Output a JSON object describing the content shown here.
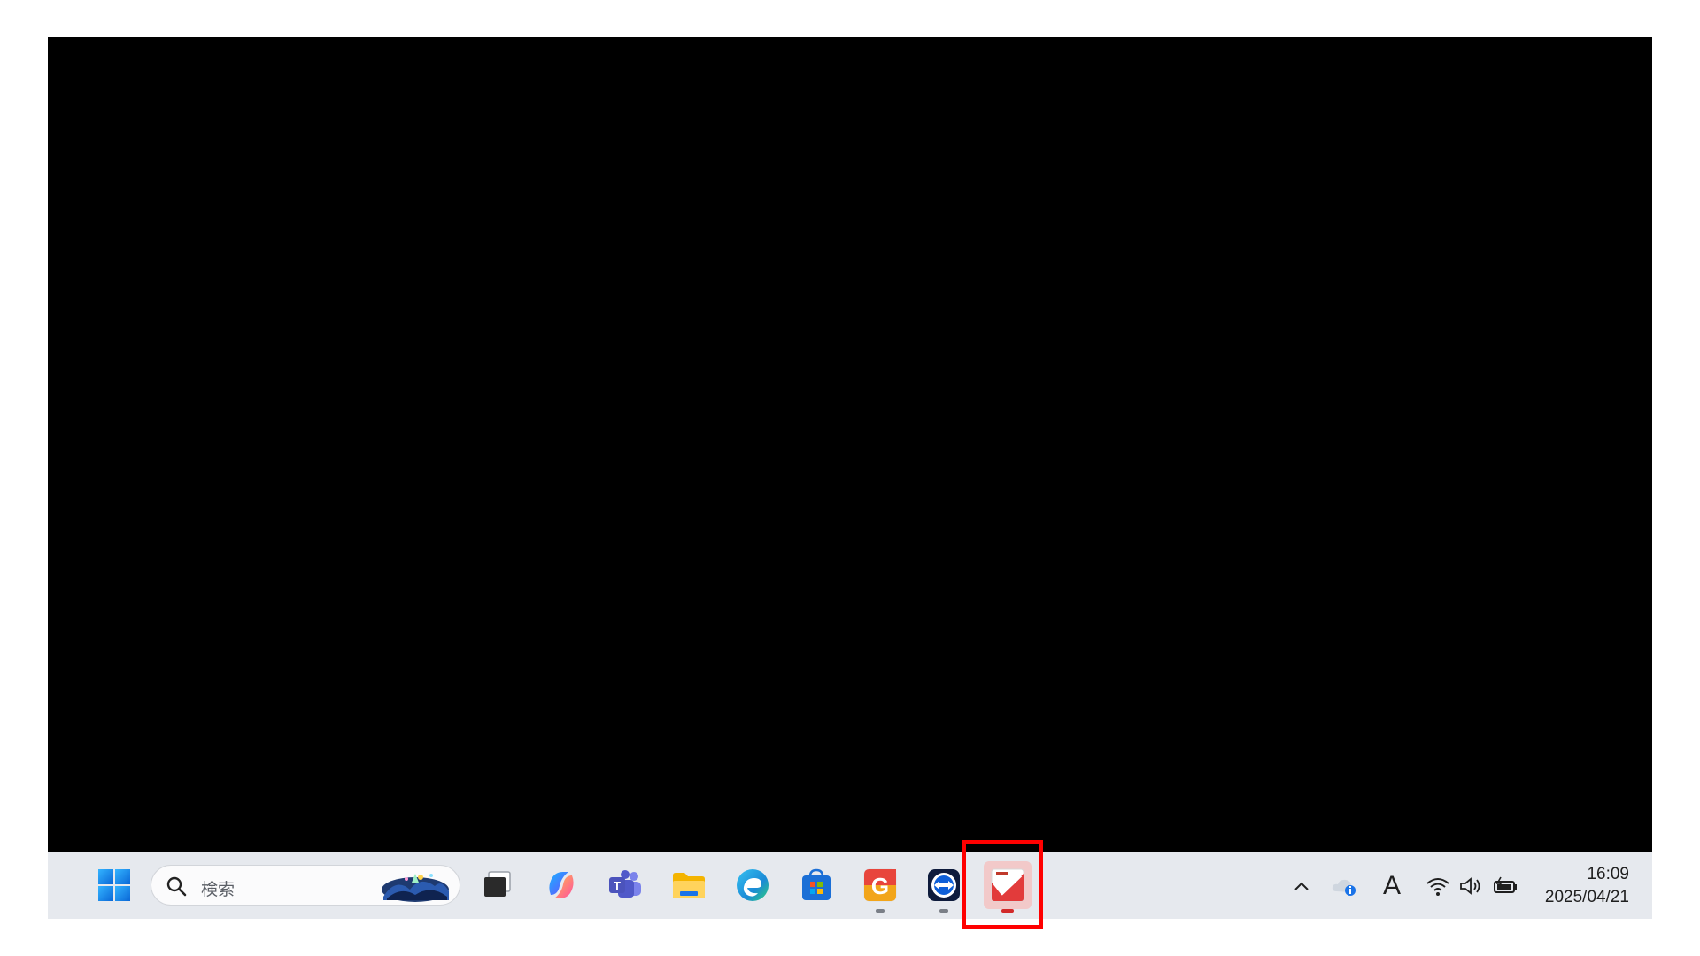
{
  "taskbar": {
    "search": {
      "placeholder": "検索"
    },
    "apps": [
      {
        "name": "start",
        "icon": "windows-logo-icon"
      },
      {
        "name": "task-view",
        "icon": "task-view-icon"
      },
      {
        "name": "copilot",
        "icon": "copilot-icon"
      },
      {
        "name": "teams",
        "icon": "teams-icon"
      },
      {
        "name": "file-explorer",
        "icon": "folder-icon"
      },
      {
        "name": "edge",
        "icon": "edge-icon"
      },
      {
        "name": "microsoft-store",
        "icon": "store-icon"
      },
      {
        "name": "g-app",
        "icon": "g-app-icon",
        "running": true
      },
      {
        "name": "teamviewer",
        "icon": "teamviewer-icon",
        "running": true
      },
      {
        "name": "checkmark-app",
        "icon": "checkmark-app-icon",
        "running": true,
        "active": true
      }
    ],
    "tray": {
      "ime_indicator": "A",
      "icons": [
        "chevron-up-icon",
        "onedrive-icon",
        "wifi-icon",
        "speaker-icon",
        "battery-icon"
      ]
    },
    "clock": {
      "time": "16:09",
      "date": "2025/04/21"
    }
  },
  "colors": {
    "desktop": "#000000",
    "taskbar": "#e6e9ee",
    "highlight": "#ff0000",
    "active_indicator": "#d22a2a"
  }
}
